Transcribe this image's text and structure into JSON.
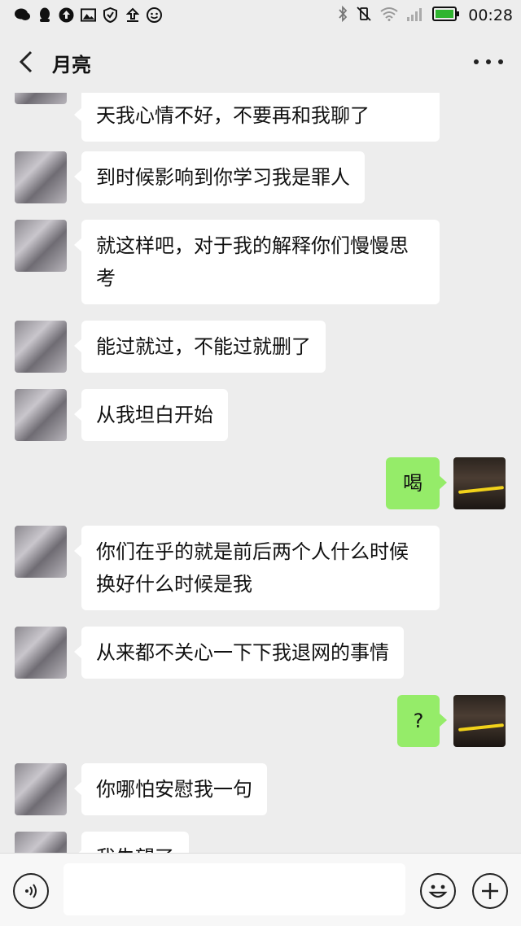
{
  "status_bar": {
    "time": "00:28",
    "left_icons": [
      "wechat-icon",
      "qq-icon",
      "upload-circle-icon",
      "image-icon",
      "shield-icon",
      "upload-icon",
      "smile-circle-icon"
    ],
    "right_icons": [
      "bluetooth-icon",
      "vibrate-off-icon",
      "wifi-icon",
      "signal-icon",
      "battery-icon"
    ],
    "battery_level": 1.0,
    "battery_color": "#2fb52f"
  },
  "nav": {
    "title": "月亮",
    "back_icon": "chevron-left-icon",
    "more_icon": "more-dots-icon"
  },
  "messages": [
    {
      "side": "left",
      "text": "天我心情不好，不要再和我聊了"
    },
    {
      "side": "left",
      "text": "到时候影响到你学习我是罪人"
    },
    {
      "side": "left",
      "text": "就这样吧，对于我的解释你们慢慢思考"
    },
    {
      "side": "left",
      "text": "能过就过，不能过就删了"
    },
    {
      "side": "left",
      "text": "从我坦白开始"
    },
    {
      "side": "right",
      "text": "喝"
    },
    {
      "side": "left",
      "text": "你们在乎的就是前后两个人什么时候换好什么时候是我"
    },
    {
      "side": "left",
      "text": "从来都不关心一下下我退网的事情"
    },
    {
      "side": "right",
      "text": "?"
    },
    {
      "side": "left",
      "text": "你哪怕安慰我一句"
    },
    {
      "side": "left",
      "text": "我失望了"
    }
  ],
  "input_bar": {
    "voice_icon": "voice-icon",
    "emoji_icon": "emoji-icon",
    "plus_icon": "plus-icon",
    "placeholder": ""
  },
  "colors": {
    "background": "#ededed",
    "bubble_left": "#ffffff",
    "bubble_right": "#95ec69"
  }
}
